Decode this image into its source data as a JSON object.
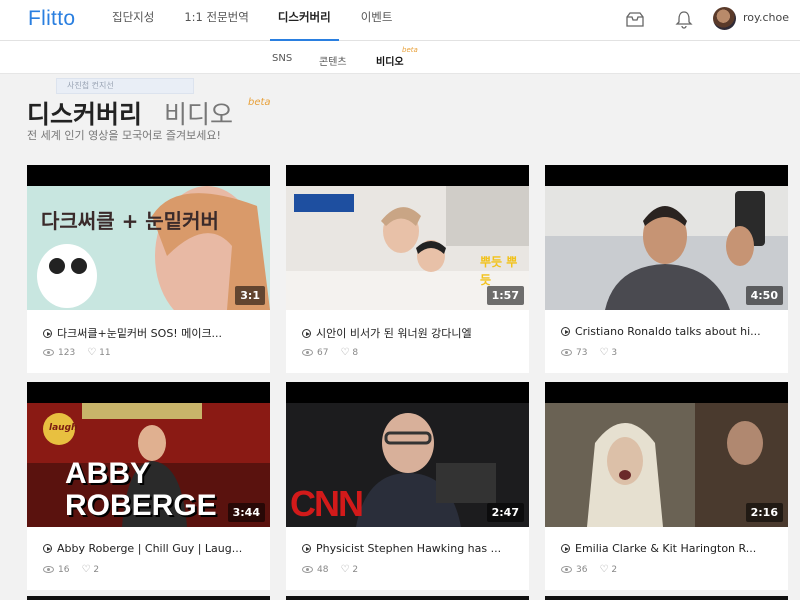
{
  "brand": {
    "logo": "Flitto",
    "accent": "#2a7fe0",
    "beta_color": "#e8a13b"
  },
  "nav": {
    "items": [
      {
        "label": "집단지성"
      },
      {
        "label": "1:1 전문번역"
      },
      {
        "label": "디스커버리",
        "active": true
      },
      {
        "label": "이벤트"
      }
    ],
    "icons": [
      "inbox-icon",
      "bell-icon"
    ],
    "user": "roy.choe"
  },
  "subnav": {
    "items": [
      {
        "label": "SNS"
      },
      {
        "label": "콘텐츠"
      },
      {
        "label": "비디오",
        "active": true
      }
    ],
    "beta": "beta"
  },
  "ghost_input": "사진첩 컨지선",
  "header": {
    "title": "디스커버리",
    "title_sub": "비디오",
    "beta": "beta",
    "description": "전 세계 인기 영상을 모국어로 즐겨보세요!"
  },
  "videos": [
    {
      "title": "다크써클+눈밑커버 SOS! 메이크...",
      "duration": "3:1",
      "views": "123",
      "likes": "11",
      "thumb_text": "다크써클 + 눈밑커버"
    },
    {
      "title": "시안이 비서가 된 워너원 강다니엘",
      "duration": "1:57",
      "views": "67",
      "likes": "8",
      "thumb_text": "뿌듯 뿌듯"
    },
    {
      "title": "Cristiano Ronaldo talks about hi...",
      "duration": "4:50",
      "views": "73",
      "likes": "3"
    },
    {
      "title": "Abby Roberge | Chill Guy | Laug...",
      "duration": "3:44",
      "views": "16",
      "likes": "2",
      "thumb_text": "ABBY ROBERGE",
      "thumb_sign": "laugh"
    },
    {
      "title": "Physicist Stephen Hawking has ...",
      "duration": "2:47",
      "views": "48",
      "likes": "2",
      "thumb_text": "CNN"
    },
    {
      "title": "Emilia Clarke & Kit Harington R...",
      "duration": "2:16",
      "views": "36",
      "likes": "2"
    }
  ]
}
